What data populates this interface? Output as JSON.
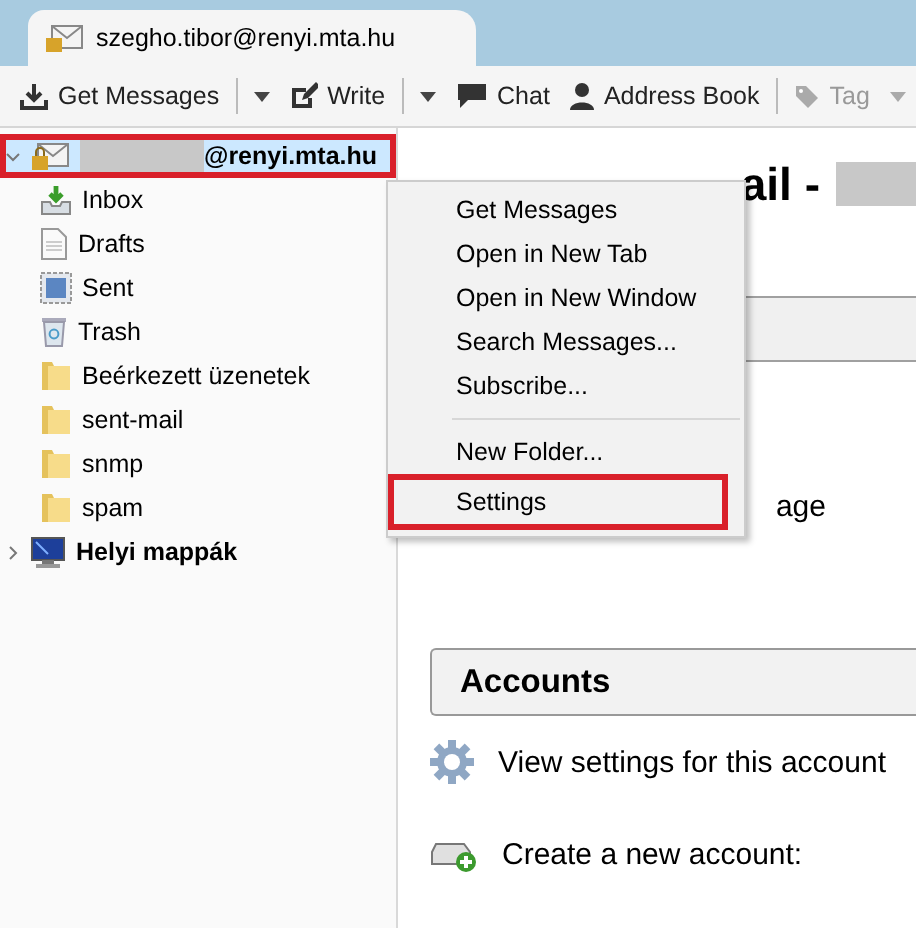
{
  "tab": {
    "title": "szegho.tibor@renyi.mta.hu"
  },
  "toolbar": [
    {
      "kind": "get",
      "label": "Get Messages",
      "dropdown": true,
      "disabled": false
    },
    {
      "kind": "write",
      "label": "Write",
      "dropdown": true,
      "disabled": false
    },
    {
      "kind": "chat",
      "label": "Chat",
      "dropdown": false,
      "disabled": false
    },
    {
      "kind": "contacts",
      "label": "Address Book",
      "dropdown": false,
      "disabled": false
    },
    {
      "kind": "tag",
      "label": "Tag",
      "dropdown": true,
      "disabled": true
    }
  ],
  "folders": [
    {
      "kind": "account",
      "label": "@renyi.mta.hu",
      "expanded": true,
      "selected": true,
      "highlighted": true,
      "children": [
        {
          "kind": "inbox",
          "label": "Inbox",
          "selected": false
        },
        {
          "kind": "drafts",
          "label": "Drafts",
          "selected": false
        },
        {
          "kind": "sent",
          "label": "Sent",
          "selected": false
        },
        {
          "kind": "trash",
          "label": "Trash",
          "selected": false
        },
        {
          "kind": "folder",
          "label": "Beérkezett üzenetek",
          "selected": false
        },
        {
          "kind": "folder",
          "label": "sent-mail",
          "selected": false
        },
        {
          "kind": "folder",
          "label": "snmp",
          "selected": false
        },
        {
          "kind": "folder",
          "label": "spam",
          "selected": false
        }
      ]
    },
    {
      "kind": "local",
      "label": "Helyi mappák",
      "expanded": false,
      "selected": false,
      "highlighted": false
    }
  ],
  "content": {
    "heading": "ail -",
    "behind_text": "age",
    "accounts": {
      "title": "Accounts",
      "items": [
        {
          "kind": "settings",
          "label": "View settings for this account"
        },
        {
          "kind": "new",
          "label": "Create a new account:"
        }
      ]
    }
  },
  "context_menu": [
    {
      "kind": "item",
      "label": "Get Messages",
      "highlighted": false
    },
    {
      "kind": "item",
      "label": "Open in New Tab",
      "highlighted": false
    },
    {
      "kind": "item",
      "label": "Open in New Window",
      "highlighted": false
    },
    {
      "kind": "item",
      "label": "Search Messages...",
      "highlighted": false
    },
    {
      "kind": "item",
      "label": "Subscribe...",
      "highlighted": false
    },
    {
      "kind": "separator"
    },
    {
      "kind": "item",
      "label": "New Folder...",
      "highlighted": false
    },
    {
      "kind": "item",
      "label": "Settings",
      "highlighted": true
    }
  ]
}
